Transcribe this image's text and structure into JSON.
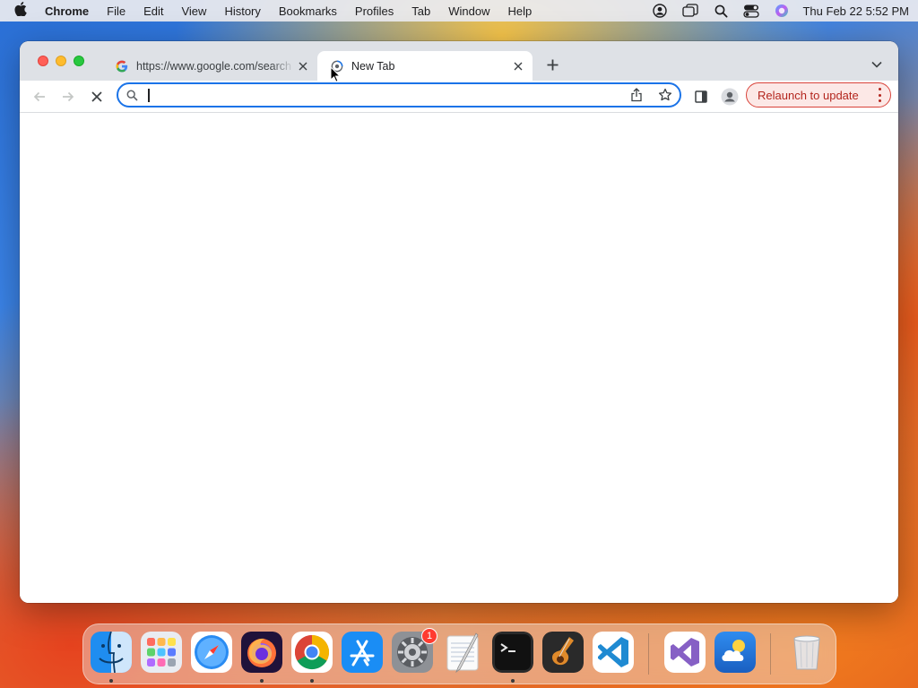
{
  "menubar": {
    "app_name": "Chrome",
    "items": [
      "File",
      "Edit",
      "View",
      "History",
      "Bookmarks",
      "Profiles",
      "Tab",
      "Window",
      "Help"
    ],
    "clock": "Thu Feb 22  5:52 PM"
  },
  "browser": {
    "tabs": [
      {
        "title": "https://www.google.com/search",
        "favicon": "google-g-icon",
        "active": false
      },
      {
        "title": "New Tab",
        "favicon": "chrome-loading-icon",
        "active": true
      }
    ],
    "omnibox": {
      "value": "",
      "placeholder": ""
    },
    "relaunch_label": "Relaunch to update",
    "accent": "#1a73e8",
    "relaunch_color": "#b3261e"
  },
  "dock": {
    "items": [
      {
        "name": "Finder",
        "running": true
      },
      {
        "name": "Launchpad",
        "running": false
      },
      {
        "name": "Safari",
        "running": false
      },
      {
        "name": "Firefox",
        "running": true
      },
      {
        "name": "Google Chrome",
        "running": true
      },
      {
        "name": "App Store",
        "running": false
      },
      {
        "name": "System Settings",
        "running": false,
        "badge": "1"
      },
      {
        "name": "TextEdit",
        "running": false
      },
      {
        "name": "Terminal",
        "running": true
      },
      {
        "name": "GarageBand",
        "running": false
      },
      {
        "name": "Visual Studio Code",
        "running": false
      },
      {
        "name": "Visual Studio",
        "running": false
      },
      {
        "name": "Weather",
        "running": false
      },
      {
        "name": "Trash",
        "running": false
      }
    ]
  }
}
